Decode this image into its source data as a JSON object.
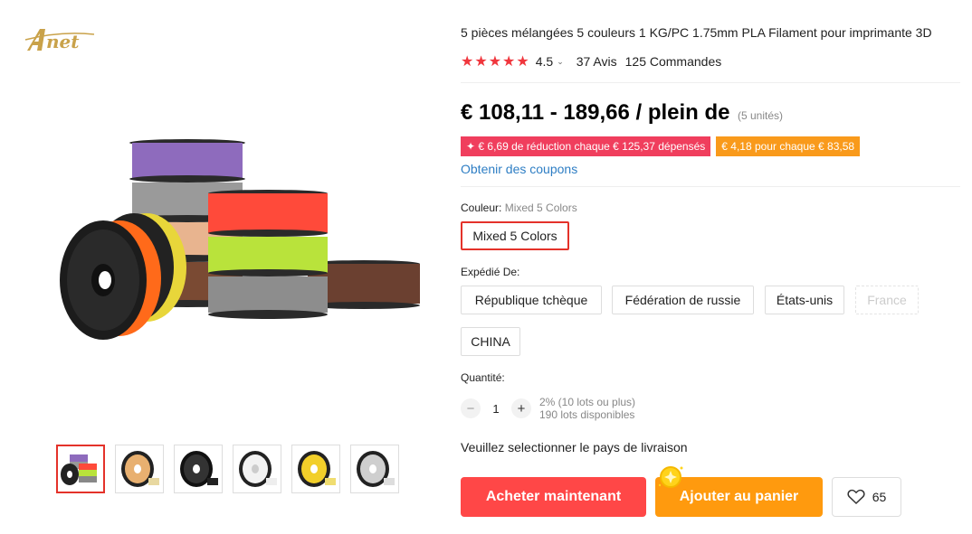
{
  "brand": {
    "logo_text": "Anet",
    "logo_color": "#c9a24a"
  },
  "product": {
    "title": "5 pièces mélangées 5 couleurs 1 KG/PC 1.75mm PLA Filament pour imprimante 3D",
    "stars": "★★★★★",
    "rating": "4.5",
    "reviews": "37 Avis",
    "orders": "125 Commandes",
    "price": "€ 108,11 - 189,66 / plein de",
    "price_unit": "(5 unités)",
    "promo_1": "✦ € 6,69 de réduction chaque € 125,37 dépensés",
    "promo_2": "€ 4,18 pour chaque € 83,58",
    "coupons_link": "Obtenir des coupons",
    "accent_color": "#ff4747"
  },
  "color": {
    "label": "Couleur:",
    "selected_value": "Mixed 5 Colors",
    "options": [
      "Mixed 5 Colors"
    ]
  },
  "shipping": {
    "label": "Expédié De:",
    "options": [
      "République tchèque",
      "Fédération de russie",
      "États-unis",
      "France",
      "CHINA"
    ],
    "unavailable": [
      "France"
    ]
  },
  "quantity": {
    "label": "Quantité:",
    "minus": "−",
    "value": "1",
    "plus": "+",
    "discount_info": "2% (10 lots ou plus)",
    "available": "190 lots disponibles"
  },
  "delivery_note": "Veuillez selectionner le pays de livraison",
  "actions": {
    "buy_now": "Acheter maintenant",
    "add_to_cart": "Ajouter au panier",
    "wishlist_count": "65"
  },
  "gallery": {
    "thumbnails": [
      "Mixed 5 Colors",
      "Skin",
      "Black",
      "White",
      "Yellow",
      "Gray"
    ],
    "selected_index": 0
  }
}
